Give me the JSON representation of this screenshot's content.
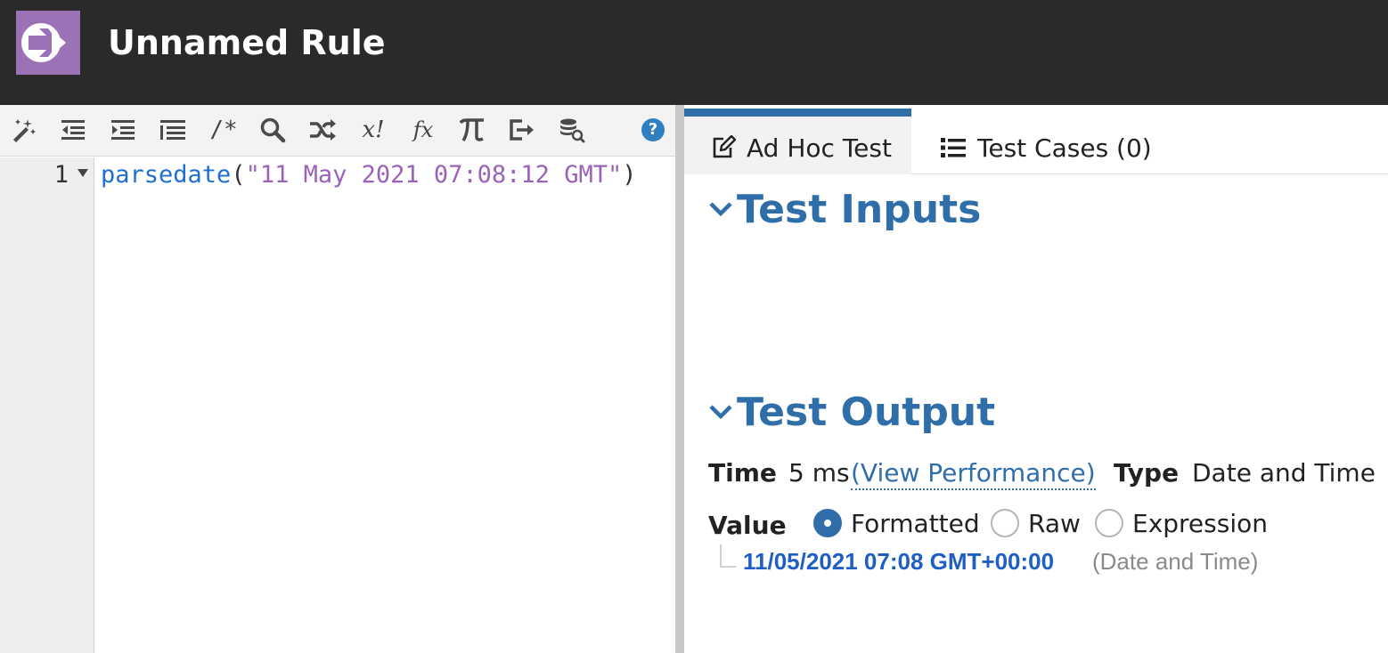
{
  "app": {
    "title": "Unnamed Rule",
    "logo_icon": "rule-arrow-logo-icon",
    "brand_color": "#9b72b5"
  },
  "toolbar": {
    "buttons": [
      {
        "name": "magic-wand-icon",
        "text": ""
      },
      {
        "name": "outdent-icon",
        "text": ""
      },
      {
        "name": "indent-icon",
        "text": ""
      },
      {
        "name": "format-list-icon",
        "text": ""
      },
      {
        "name": "comment-icon",
        "text": "/*"
      },
      {
        "name": "search-icon",
        "text": ""
      },
      {
        "name": "shuffle-icon",
        "text": ""
      },
      {
        "name": "factorial-icon",
        "text": "x!"
      },
      {
        "name": "function-icon",
        "text": "fx"
      },
      {
        "name": "pi-icon",
        "text": ""
      },
      {
        "name": "export-icon",
        "text": ""
      },
      {
        "name": "database-search-icon",
        "text": ""
      }
    ],
    "help_label": "?"
  },
  "editor": {
    "line_number": "1",
    "code_fn": "parsedate",
    "code_open": "(",
    "code_string": "\"11 May 2021 07:08:12 GMT\"",
    "code_close": ")"
  },
  "tabs": [
    {
      "label": "Ad Hoc Test",
      "icon": "edit-icon",
      "active": true
    },
    {
      "label": "Test Cases (0)",
      "icon": "list-icon",
      "active": false
    }
  ],
  "test_inputs": {
    "title": "Test Inputs"
  },
  "test_output": {
    "title": "Test Output",
    "time_label": "Time",
    "time_value": "5 ms",
    "performance_link": "(View Performance)",
    "type_label": "Type",
    "type_value": "Date and Time",
    "value_label": "Value",
    "value_modes": [
      {
        "label": "Formatted",
        "checked": true
      },
      {
        "label": "Raw",
        "checked": false
      },
      {
        "label": "Expression",
        "checked": false
      }
    ],
    "result": "11/05/2021 07:08 GMT+00:00",
    "result_type": "(Date and Time)"
  }
}
